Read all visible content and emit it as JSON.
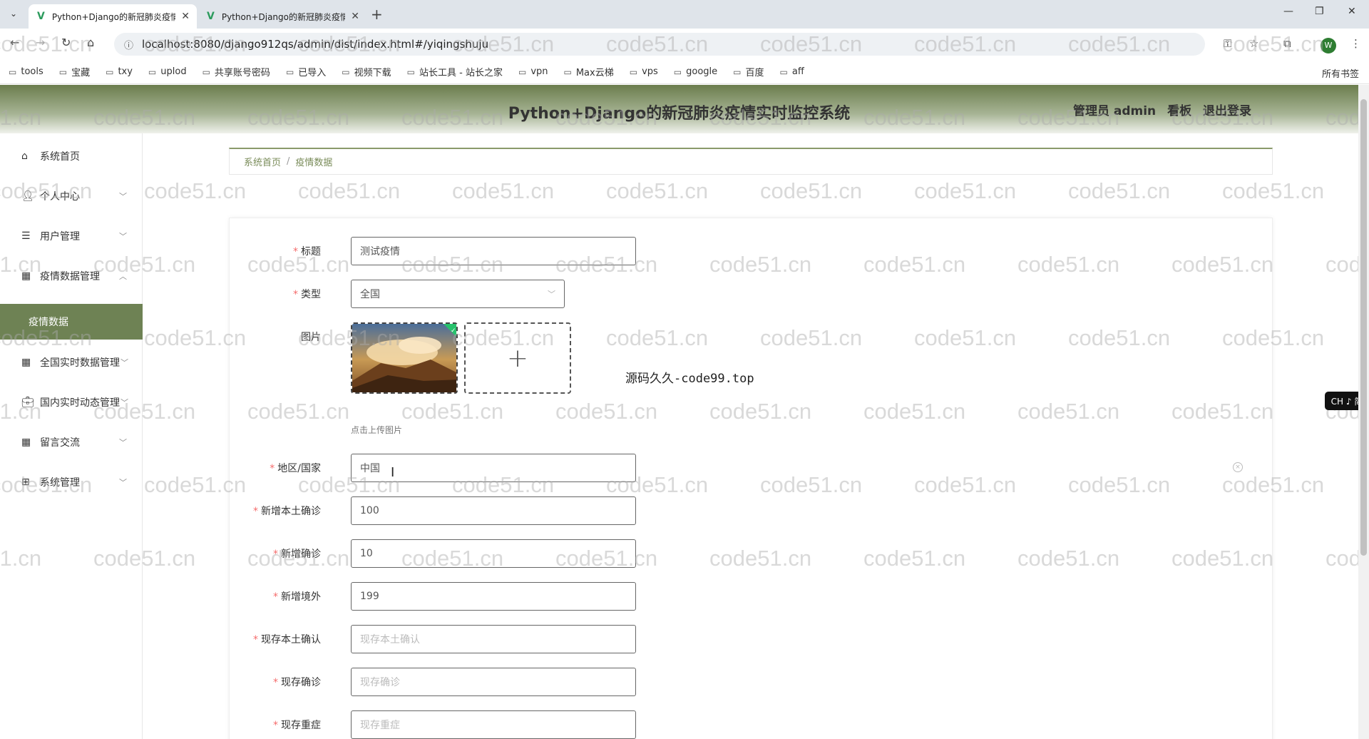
{
  "browser": {
    "tabs": [
      {
        "title": "Python+Django的新冠肺炎疫情",
        "active": true
      },
      {
        "title": "Python+Django的新冠肺炎疫情",
        "active": false
      }
    ],
    "url": "localhost:8080/django912qs/admin/dist/index.html#/yiqingshuju",
    "bookmarks": [
      "tools",
      "宝藏",
      "txy",
      "uplod",
      "共享账号密码",
      "已导入",
      "视频下载",
      "站长工具 - 站长之家",
      "vpn",
      "Max云梯",
      "vps",
      "google",
      "百度",
      "aff"
    ],
    "bookmarks_right": "所有书签",
    "profile_initial": "W"
  },
  "header": {
    "title": "Python+Django的新冠肺炎疫情实时监控系统",
    "admin_label": "管理员 admin",
    "board_label": "看板",
    "logout_label": "退出登录"
  },
  "sidebar": {
    "items": [
      {
        "label": "系统首页",
        "icon": "home-icon"
      },
      {
        "label": "个人中心",
        "icon": "user-icon"
      },
      {
        "label": "用户管理",
        "icon": "list-icon"
      },
      {
        "label": "疫情数据管理",
        "icon": "grid-icon"
      },
      {
        "label": "疫情数据",
        "icon": ""
      },
      {
        "label": "全国实时数据管理",
        "icon": "grid-icon"
      },
      {
        "label": "国内实时动态管理",
        "icon": "briefcase-icon"
      },
      {
        "label": "留言交流",
        "icon": "grid-icon"
      },
      {
        "label": "系统管理",
        "icon": "apps-icon"
      }
    ]
  },
  "breadcrumb": {
    "home": "系统首页",
    "current": "疫情数据"
  },
  "form": {
    "title_label": "标题",
    "title_value": "测试疫情",
    "type_label": "类型",
    "type_value": "全国",
    "image_label": "图片",
    "upload_tip": "点击上传图片",
    "region_label": "地区/国家",
    "region_value": "中国",
    "new_local_label": "新增本土确诊",
    "new_local_value": "100",
    "new_confirm_label": "新增确诊",
    "new_confirm_value": "10",
    "new_abroad_label": "新增境外",
    "new_abroad_value": "199",
    "cur_local_label": "现存本土确认",
    "cur_local_placeholder": "现存本土确认",
    "cur_confirm_label": "现存确诊",
    "cur_confirm_placeholder": "现存确诊",
    "cur_severe_label": "现存重症",
    "cur_severe_placeholder": "现存重症"
  },
  "promo_text": "源码久久-code99.top",
  "watermark_text": "code51.cn",
  "ime_text": "CH ♪ 简",
  "colors": {
    "accent": "#6e8254",
    "required": "#f56c6c"
  }
}
